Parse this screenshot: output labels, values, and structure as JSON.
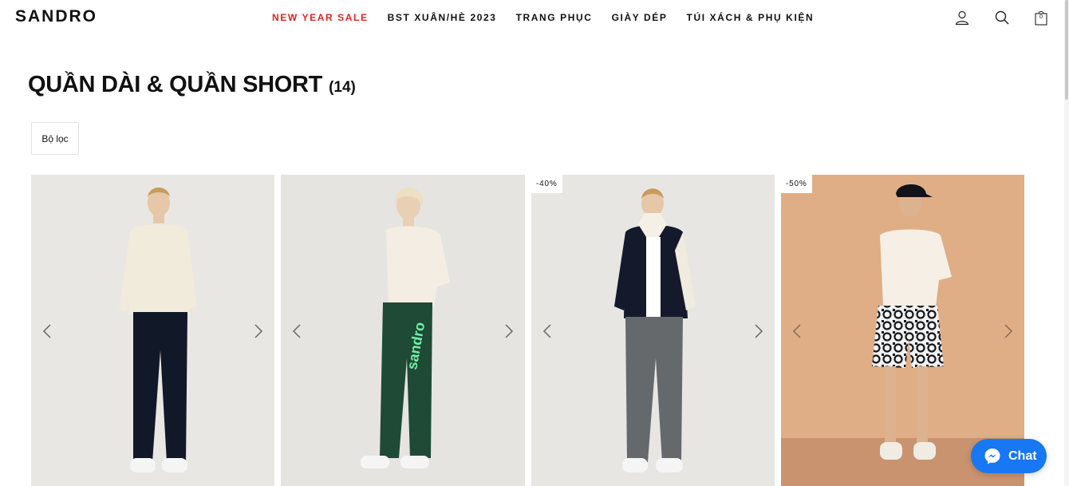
{
  "header": {
    "logo": "SANDRO",
    "nav": [
      {
        "label": "NEW YEAR SALE",
        "highlight": true
      },
      {
        "label": "BST XUÂN/HÈ 2023",
        "highlight": false
      },
      {
        "label": "TRANG PHỤC",
        "highlight": false
      },
      {
        "label": "GIÀY DÉP",
        "highlight": false
      },
      {
        "label": "TÚI XÁCH & PHỤ KIỆN",
        "highlight": false
      }
    ],
    "icons": [
      "user-icon",
      "search-icon",
      "bag-icon"
    ],
    "bag_count": "0"
  },
  "category": {
    "title": "QUẦN DÀI & QUẦN SHORT",
    "count": "(14)"
  },
  "filter": {
    "label": "Bộ lọc"
  },
  "products": [
    {
      "badge": "",
      "top_color": "#f1ebdc",
      "bottom_color": "#111827",
      "bg": "#e9e7e3"
    },
    {
      "badge": "",
      "top_color": "#f3ede3",
      "bottom_color": "#1e4a36",
      "bg": "#e6e4e1"
    },
    {
      "badge": "-40%",
      "top_color": "#141a2c",
      "bottom_color": "#66696c",
      "bg": "#e8e6e3"
    },
    {
      "badge": "-50%",
      "top_color": "#f5efe6",
      "bottom_color": "#1d1d1d",
      "bg": "#dfae86"
    }
  ],
  "chat": {
    "label": "Chat",
    "color": "#1877f2"
  },
  "colors": {
    "sale": "#e0251b"
  }
}
